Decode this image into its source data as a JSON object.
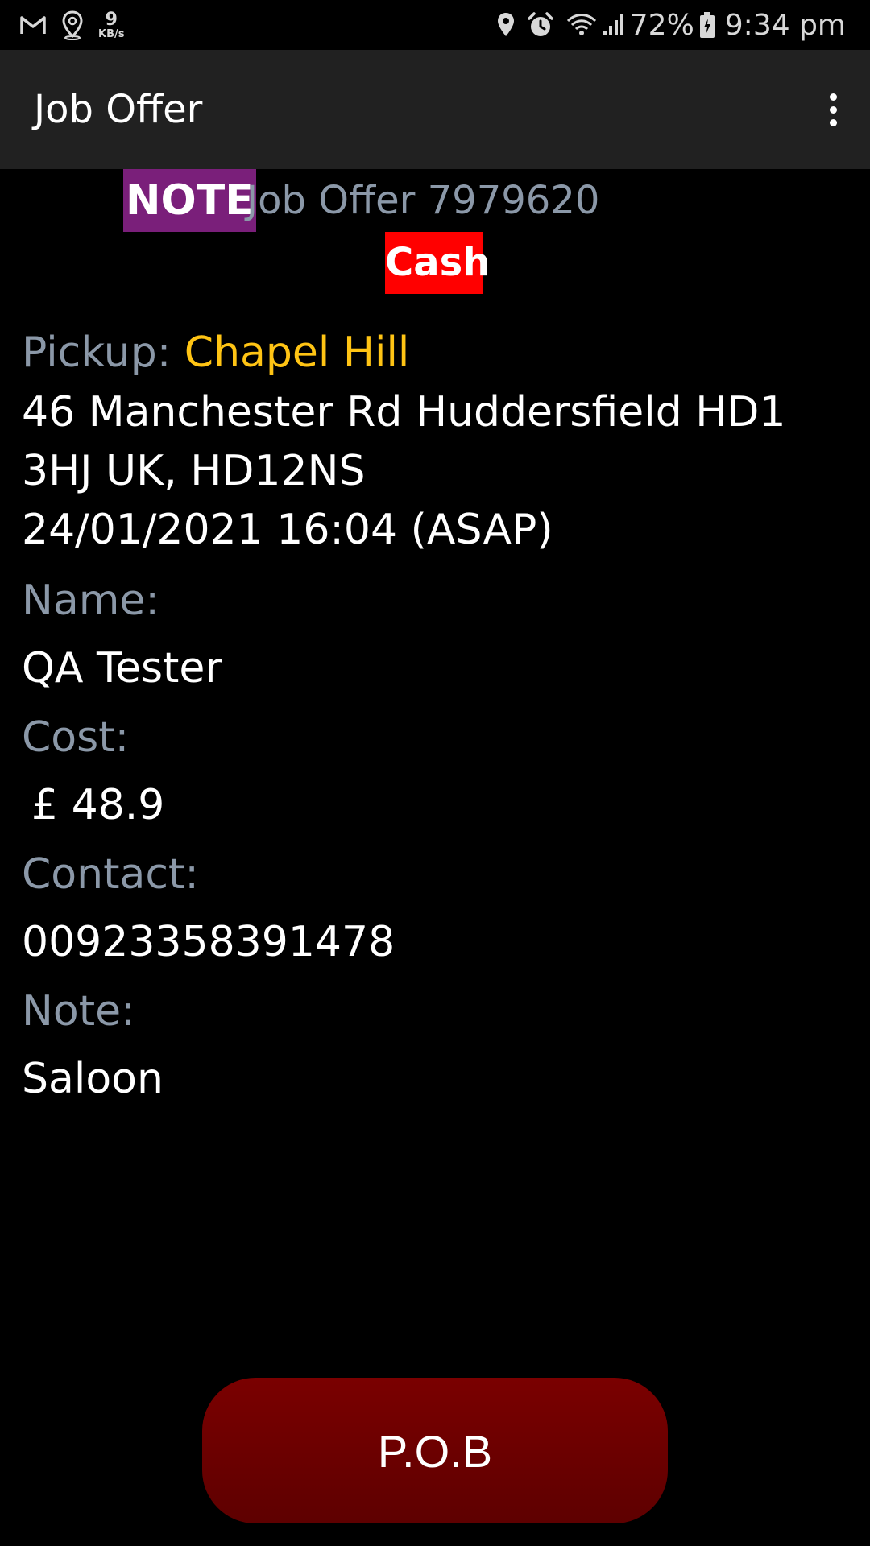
{
  "status_bar": {
    "network_speed_value": "9",
    "network_speed_unit": "KB/s",
    "battery": "72%",
    "time": "9:34 pm",
    "icons": [
      "gmail-icon",
      "location-pin-icon",
      "location-icon",
      "alarm-icon",
      "wifi-icon",
      "signal-icon",
      "battery-charging-icon"
    ]
  },
  "app_bar": {
    "title": "Job Offer",
    "menu_icon": "overflow-menu-icon"
  },
  "header": {
    "note_badge": "NOTE",
    "job_title": "Job Offer 7979620",
    "payment_badge": "Cash"
  },
  "details": {
    "pickup_label": "Pickup:",
    "pickup_place": "Chapel Hill",
    "address_line1": "46 Manchester Rd Huddersfield HD1",
    "address_line2": "3HJ UK, HD12NS",
    "datetime": "24/01/2021 16:04 (ASAP)",
    "name_label": "Name:",
    "name_value": "QA Tester",
    "cost_label": "Cost:",
    "cost_value": "£ 48.9",
    "contact_label": "Contact:",
    "contact_value": "00923358391478",
    "note_label": "Note:",
    "note_value": "Saloon"
  },
  "actions": {
    "pob_label": "P.O.B"
  },
  "colors": {
    "note_badge_bg": "#7a1f7a",
    "cash_badge_bg": "#ff0000",
    "pickup_place": "#ffc414",
    "label_gray": "#8b98a8",
    "button_bg": "#6a0000",
    "app_bar_bg": "#212121"
  }
}
